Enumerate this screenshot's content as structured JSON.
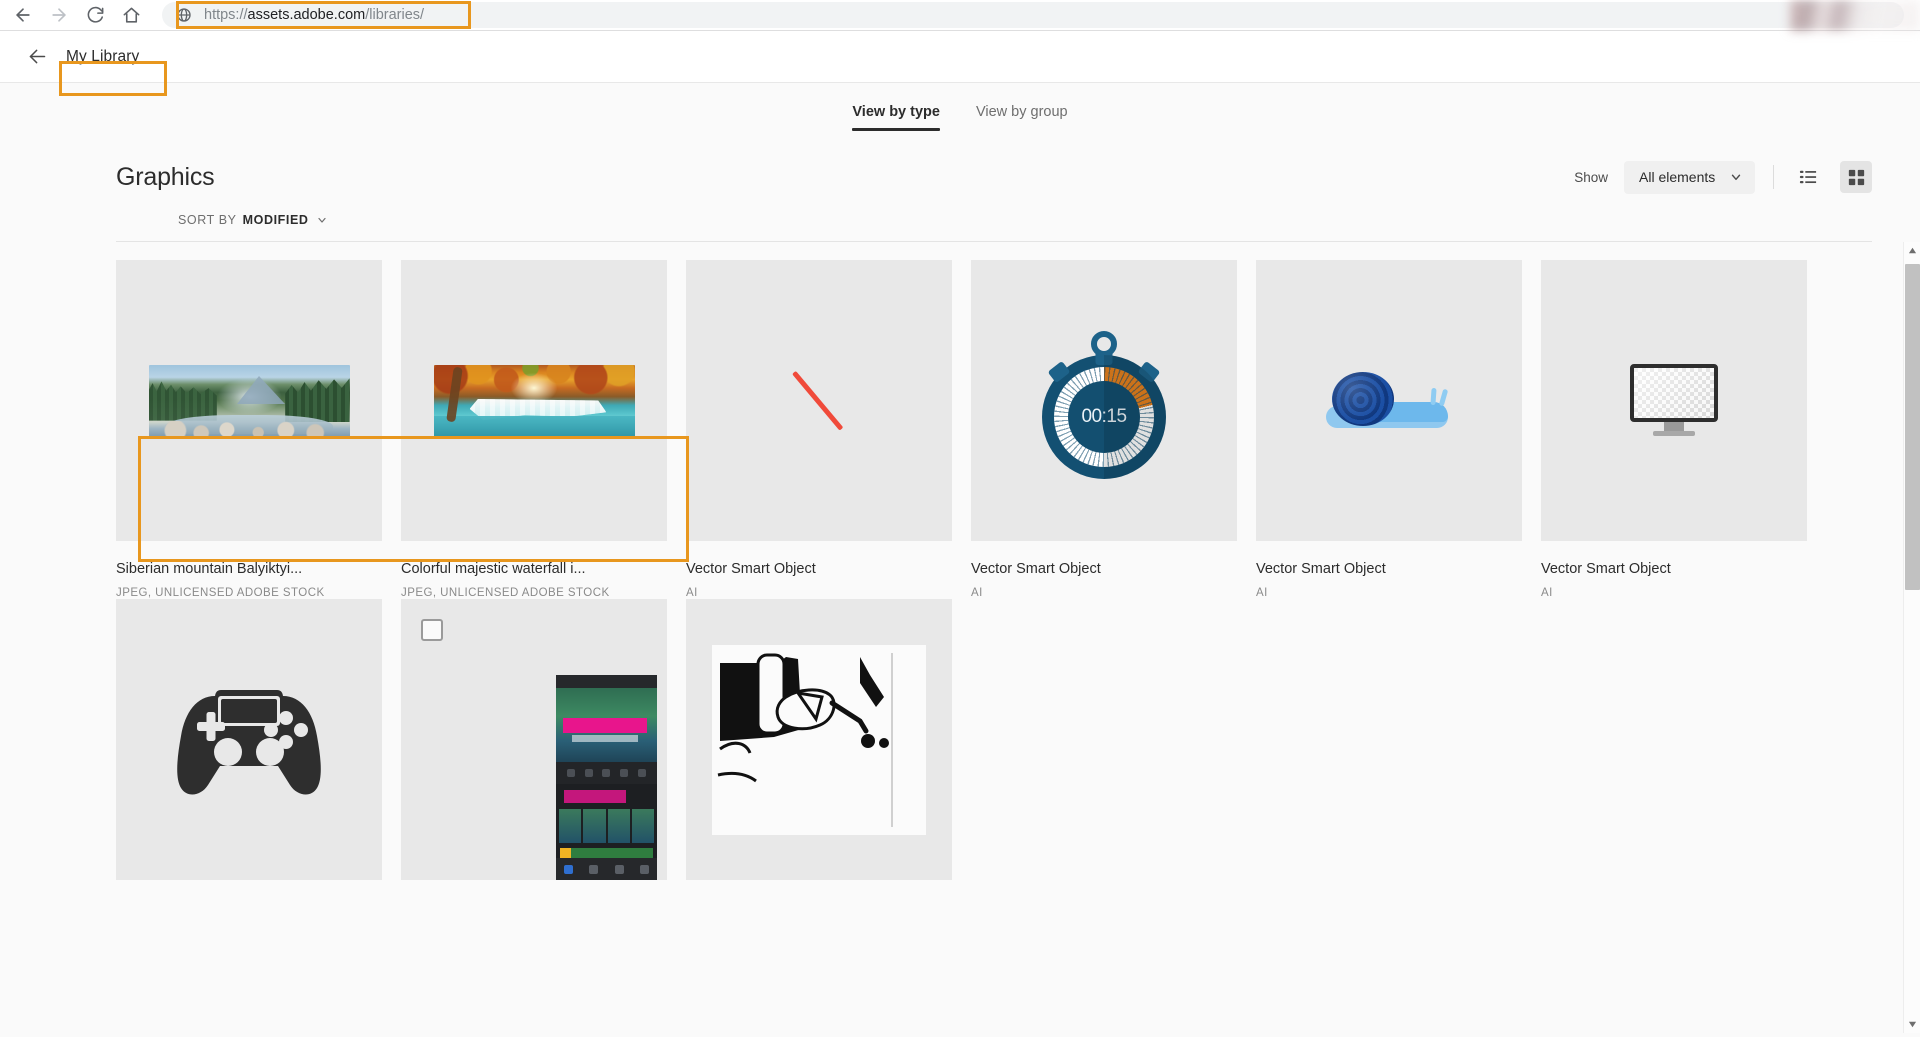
{
  "browser": {
    "back_icon": "back-arrow-icon",
    "forward_icon": "forward-arrow-icon",
    "reload_icon": "reload-icon",
    "home_icon": "home-icon",
    "site_icon": "globe-icon",
    "url_scheme": "https://",
    "url_host": "assets.adobe.com",
    "url_path": "/libraries/",
    "url_full": "https://assets.adobe.com/libraries/"
  },
  "header": {
    "back_icon": "back-arrow-icon",
    "library_title": "My Library"
  },
  "tabs": [
    {
      "label": "View by type",
      "active": true
    },
    {
      "label": "View by group",
      "active": false
    }
  ],
  "section": {
    "title": "Graphics",
    "show_label": "Show",
    "filter_value": "All elements",
    "filter_chevron": "chevron-down-icon",
    "list_view_icon": "list-view-icon",
    "grid_view_icon": "grid-view-icon",
    "sort_label": "SORT BY",
    "sort_value": "MODIFIED",
    "sort_chevron": "chevron-down-icon"
  },
  "assets": [
    {
      "title": "Siberian mountain Balyiktyi...",
      "meta": "JPEG, UNLICENSED ADOBE STOCK",
      "art": "mountain-photo",
      "selected": true
    },
    {
      "title": "Colorful majestic waterfall i...",
      "meta": "JPEG, UNLICENSED ADOBE STOCK",
      "art": "waterfall-photo",
      "selected": true
    },
    {
      "title": "Vector Smart Object",
      "meta": "AI",
      "art": "red-diagonal-line",
      "selected": false
    },
    {
      "title": "Vector Smart Object",
      "meta": "AI",
      "art": "stopwatch",
      "selected": false
    },
    {
      "title": "Vector Smart Object",
      "meta": "AI",
      "art": "snail",
      "selected": false
    },
    {
      "title": "Vector Smart Object",
      "meta": "AI",
      "art": "monitor",
      "selected": false
    },
    {
      "title": "",
      "meta": "",
      "art": "gamepad",
      "selected": false
    },
    {
      "title": "",
      "meta": "",
      "art": "phone-app-mockup",
      "selected": false
    },
    {
      "title": "",
      "meta": "",
      "art": "bw-sketch-photo",
      "selected": false
    }
  ],
  "stopwatch": {
    "time": "00:15"
  },
  "scrollbar": {
    "up_icon": "scroll-up-arrow-icon",
    "down_icon": "scroll-down-arrow-icon"
  },
  "annotations": {
    "accent_color": "#e8971e",
    "url_box": "url-highlight",
    "library_box": "my-library-highlight",
    "images_box": "selected-images-highlight"
  }
}
